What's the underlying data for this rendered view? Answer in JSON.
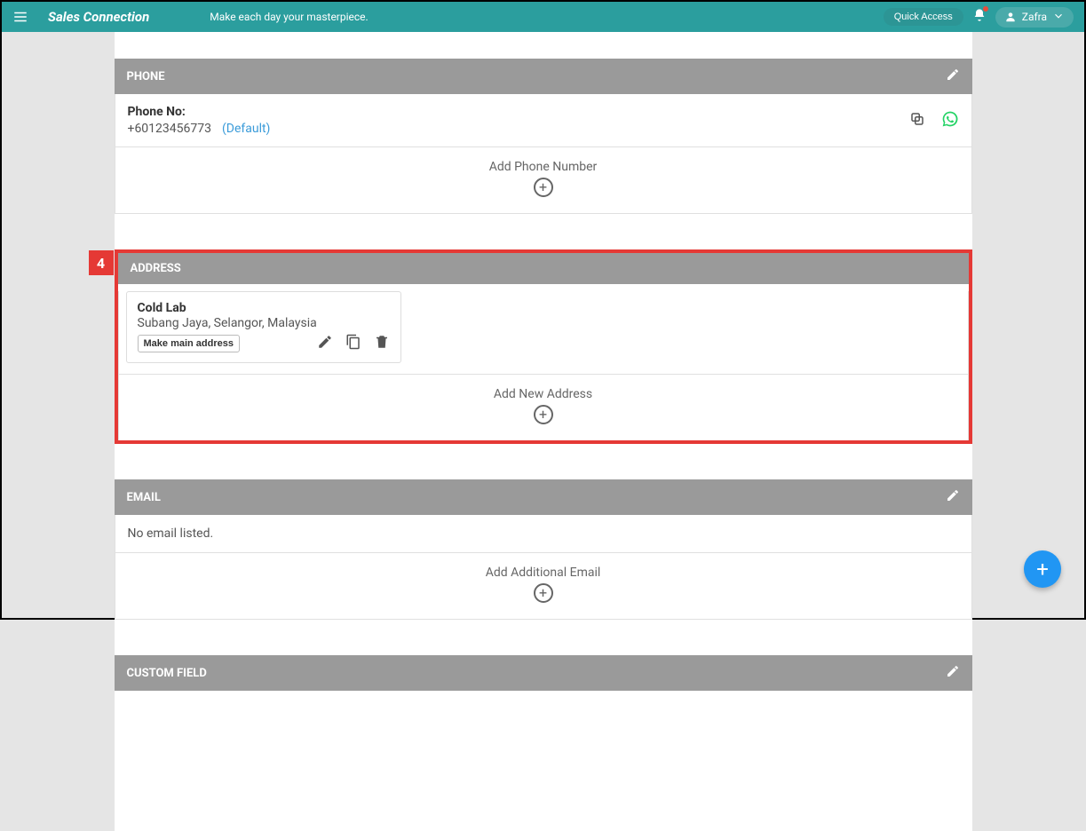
{
  "header": {
    "brand": "Sales Connection",
    "tagline": "Make each day your masterpiece.",
    "quick_access": "Quick Access",
    "user": "Zafra"
  },
  "callout_number": "4",
  "phone": {
    "title": "PHONE",
    "label": "Phone No:",
    "value": "+60123456773",
    "default_tag": "(Default)",
    "add_label": "Add Phone Number"
  },
  "address": {
    "title": "ADDRESS",
    "card": {
      "name": "Cold Lab",
      "location": "Subang Jaya, Selangor, Malaysia",
      "make_main": "Make main address"
    },
    "add_label": "Add New Address"
  },
  "email": {
    "title": "EMAIL",
    "empty": "No email listed.",
    "add_label": "Add Additional Email"
  },
  "custom": {
    "title": "CUSTOM FIELD"
  }
}
